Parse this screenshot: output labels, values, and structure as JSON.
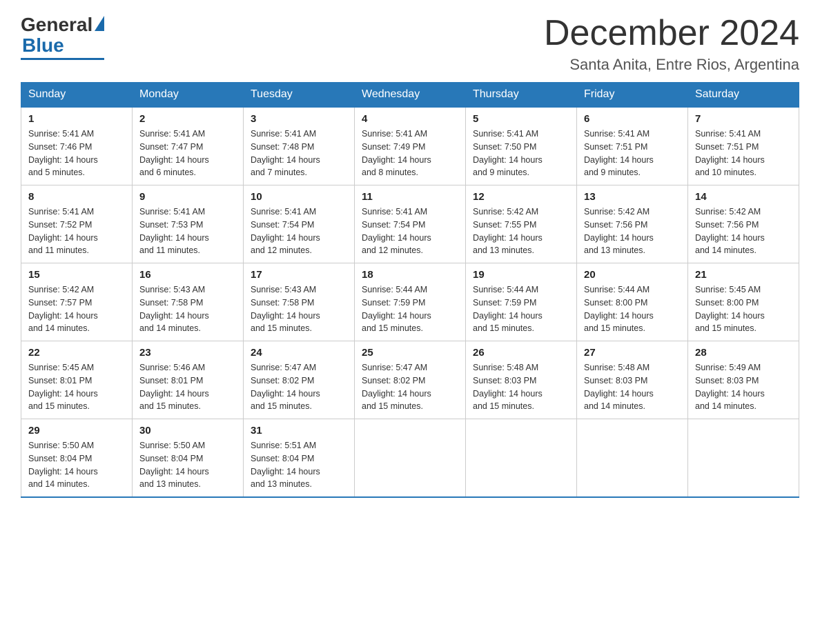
{
  "logo": {
    "general": "General",
    "blue": "Blue"
  },
  "title": "December 2024",
  "location": "Santa Anita, Entre Rios, Argentina",
  "days_of_week": [
    "Sunday",
    "Monday",
    "Tuesday",
    "Wednesday",
    "Thursday",
    "Friday",
    "Saturday"
  ],
  "weeks": [
    [
      {
        "day": "1",
        "sunrise": "5:41 AM",
        "sunset": "7:46 PM",
        "daylight": "14 hours and 5 minutes."
      },
      {
        "day": "2",
        "sunrise": "5:41 AM",
        "sunset": "7:47 PM",
        "daylight": "14 hours and 6 minutes."
      },
      {
        "day": "3",
        "sunrise": "5:41 AM",
        "sunset": "7:48 PM",
        "daylight": "14 hours and 7 minutes."
      },
      {
        "day": "4",
        "sunrise": "5:41 AM",
        "sunset": "7:49 PM",
        "daylight": "14 hours and 8 minutes."
      },
      {
        "day": "5",
        "sunrise": "5:41 AM",
        "sunset": "7:50 PM",
        "daylight": "14 hours and 9 minutes."
      },
      {
        "day": "6",
        "sunrise": "5:41 AM",
        "sunset": "7:51 PM",
        "daylight": "14 hours and 9 minutes."
      },
      {
        "day": "7",
        "sunrise": "5:41 AM",
        "sunset": "7:51 PM",
        "daylight": "14 hours and 10 minutes."
      }
    ],
    [
      {
        "day": "8",
        "sunrise": "5:41 AM",
        "sunset": "7:52 PM",
        "daylight": "14 hours and 11 minutes."
      },
      {
        "day": "9",
        "sunrise": "5:41 AM",
        "sunset": "7:53 PM",
        "daylight": "14 hours and 11 minutes."
      },
      {
        "day": "10",
        "sunrise": "5:41 AM",
        "sunset": "7:54 PM",
        "daylight": "14 hours and 12 minutes."
      },
      {
        "day": "11",
        "sunrise": "5:41 AM",
        "sunset": "7:54 PM",
        "daylight": "14 hours and 12 minutes."
      },
      {
        "day": "12",
        "sunrise": "5:42 AM",
        "sunset": "7:55 PM",
        "daylight": "14 hours and 13 minutes."
      },
      {
        "day": "13",
        "sunrise": "5:42 AM",
        "sunset": "7:56 PM",
        "daylight": "14 hours and 13 minutes."
      },
      {
        "day": "14",
        "sunrise": "5:42 AM",
        "sunset": "7:56 PM",
        "daylight": "14 hours and 14 minutes."
      }
    ],
    [
      {
        "day": "15",
        "sunrise": "5:42 AM",
        "sunset": "7:57 PM",
        "daylight": "14 hours and 14 minutes."
      },
      {
        "day": "16",
        "sunrise": "5:43 AM",
        "sunset": "7:58 PM",
        "daylight": "14 hours and 14 minutes."
      },
      {
        "day": "17",
        "sunrise": "5:43 AM",
        "sunset": "7:58 PM",
        "daylight": "14 hours and 15 minutes."
      },
      {
        "day": "18",
        "sunrise": "5:44 AM",
        "sunset": "7:59 PM",
        "daylight": "14 hours and 15 minutes."
      },
      {
        "day": "19",
        "sunrise": "5:44 AM",
        "sunset": "7:59 PM",
        "daylight": "14 hours and 15 minutes."
      },
      {
        "day": "20",
        "sunrise": "5:44 AM",
        "sunset": "8:00 PM",
        "daylight": "14 hours and 15 minutes."
      },
      {
        "day": "21",
        "sunrise": "5:45 AM",
        "sunset": "8:00 PM",
        "daylight": "14 hours and 15 minutes."
      }
    ],
    [
      {
        "day": "22",
        "sunrise": "5:45 AM",
        "sunset": "8:01 PM",
        "daylight": "14 hours and 15 minutes."
      },
      {
        "day": "23",
        "sunrise": "5:46 AM",
        "sunset": "8:01 PM",
        "daylight": "14 hours and 15 minutes."
      },
      {
        "day": "24",
        "sunrise": "5:47 AM",
        "sunset": "8:02 PM",
        "daylight": "14 hours and 15 minutes."
      },
      {
        "day": "25",
        "sunrise": "5:47 AM",
        "sunset": "8:02 PM",
        "daylight": "14 hours and 15 minutes."
      },
      {
        "day": "26",
        "sunrise": "5:48 AM",
        "sunset": "8:03 PM",
        "daylight": "14 hours and 15 minutes."
      },
      {
        "day": "27",
        "sunrise": "5:48 AM",
        "sunset": "8:03 PM",
        "daylight": "14 hours and 14 minutes."
      },
      {
        "day": "28",
        "sunrise": "5:49 AM",
        "sunset": "8:03 PM",
        "daylight": "14 hours and 14 minutes."
      }
    ],
    [
      {
        "day": "29",
        "sunrise": "5:50 AM",
        "sunset": "8:04 PM",
        "daylight": "14 hours and 14 minutes."
      },
      {
        "day": "30",
        "sunrise": "5:50 AM",
        "sunset": "8:04 PM",
        "daylight": "14 hours and 13 minutes."
      },
      {
        "day": "31",
        "sunrise": "5:51 AM",
        "sunset": "8:04 PM",
        "daylight": "14 hours and 13 minutes."
      },
      null,
      null,
      null,
      null
    ]
  ],
  "labels": {
    "sunrise": "Sunrise:",
    "sunset": "Sunset:",
    "daylight": "Daylight:"
  }
}
